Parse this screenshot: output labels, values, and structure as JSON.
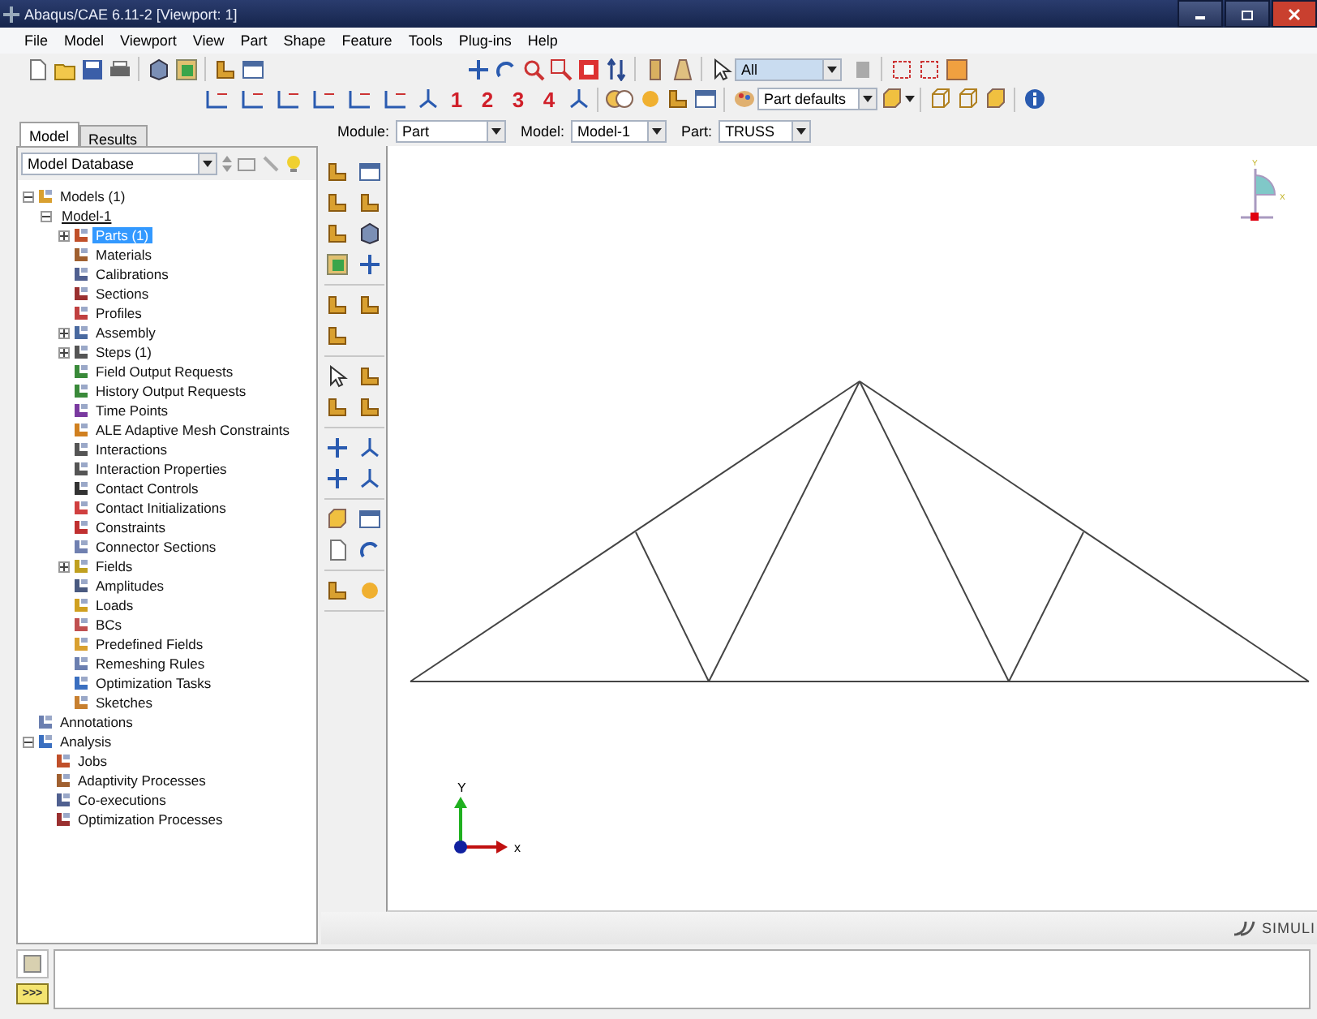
{
  "window": {
    "title": "Abaqus/CAE 6.11-2 [Viewport: 1]"
  },
  "menu": [
    "File",
    "Model",
    "Viewport",
    "View",
    "Part",
    "Shape",
    "Feature",
    "Tools",
    "Plug-ins",
    "Help"
  ],
  "toolbar": {
    "selection_filter": "All",
    "view_buttons": [
      "1",
      "2",
      "3",
      "4"
    ],
    "render_style": "Part defaults"
  },
  "panel_tabs": [
    {
      "label": "Model",
      "selected": true
    },
    {
      "label": "Results",
      "selected": false
    }
  ],
  "context_bar": [
    {
      "label": "Module:",
      "value": "Part"
    },
    {
      "label": "Model:",
      "value": "Model-1"
    },
    {
      "label": "Part:",
      "value": "TRUSS"
    }
  ],
  "tree": {
    "source": "Model Database",
    "items": [
      {
        "label": "Models (1)",
        "kind": "item",
        "expanded": true,
        "selected": false,
        "children": [
          {
            "label": "Model-1",
            "kind": "model",
            "expanded": true,
            "selected": false,
            "children": [
              {
                "label": "Parts (1)",
                "kind": "item",
                "expanded": false,
                "selected": true
              },
              {
                "label": "Materials",
                "kind": "item",
                "selected": false
              },
              {
                "label": "Calibrations",
                "kind": "item",
                "selected": false
              },
              {
                "label": "Sections",
                "kind": "item",
                "selected": false
              },
              {
                "label": "Profiles",
                "kind": "item",
                "selected": false
              },
              {
                "label": "Assembly",
                "kind": "item",
                "expanded": false,
                "selected": false
              },
              {
                "label": "Steps (1)",
                "kind": "item",
                "expanded": false,
                "selected": false
              },
              {
                "label": "Field Output Requests",
                "kind": "item",
                "selected": false
              },
              {
                "label": "History Output Requests",
                "kind": "item",
                "selected": false
              },
              {
                "label": "Time Points",
                "kind": "item",
                "selected": false
              },
              {
                "label": "ALE Adaptive Mesh Constraints",
                "kind": "item",
                "selected": false
              },
              {
                "label": "Interactions",
                "kind": "item",
                "selected": false
              },
              {
                "label": "Interaction Properties",
                "kind": "item",
                "selected": false
              },
              {
                "label": "Contact Controls",
                "kind": "item",
                "selected": false
              },
              {
                "label": "Contact Initializations",
                "kind": "item",
                "selected": false
              },
              {
                "label": "Constraints",
                "kind": "item",
                "selected": false
              },
              {
                "label": "Connector Sections",
                "kind": "item",
                "selected": false
              },
              {
                "label": "Fields",
                "kind": "item",
                "expanded": false,
                "selected": false
              },
              {
                "label": "Amplitudes",
                "kind": "item",
                "selected": false
              },
              {
                "label": "Loads",
                "kind": "item",
                "selected": false
              },
              {
                "label": "BCs",
                "kind": "item",
                "selected": false
              },
              {
                "label": "Predefined Fields",
                "kind": "item",
                "selected": false
              },
              {
                "label": "Remeshing Rules",
                "kind": "item",
                "selected": false
              },
              {
                "label": "Optimization Tasks",
                "kind": "item",
                "selected": false
              },
              {
                "label": "Sketches",
                "kind": "item",
                "selected": false
              }
            ]
          }
        ]
      },
      {
        "label": "Annotations",
        "kind": "item",
        "selected": false
      },
      {
        "label": "Analysis",
        "kind": "item",
        "expanded": true,
        "selected": false,
        "children": [
          {
            "label": "Jobs",
            "kind": "item",
            "selected": false
          },
          {
            "label": "Adaptivity Processes",
            "kind": "item",
            "selected": false
          },
          {
            "label": "Co-executions",
            "kind": "item",
            "selected": false
          },
          {
            "label": "Optimization Processes",
            "kind": "item",
            "selected": false
          }
        ]
      }
    ]
  },
  "viewport": {
    "triad": {
      "y": "Y",
      "x": "x"
    },
    "view_cube": {
      "y": "Y",
      "x": "X"
    }
  },
  "brand": "SIMULI",
  "command_prompt": ">>>"
}
